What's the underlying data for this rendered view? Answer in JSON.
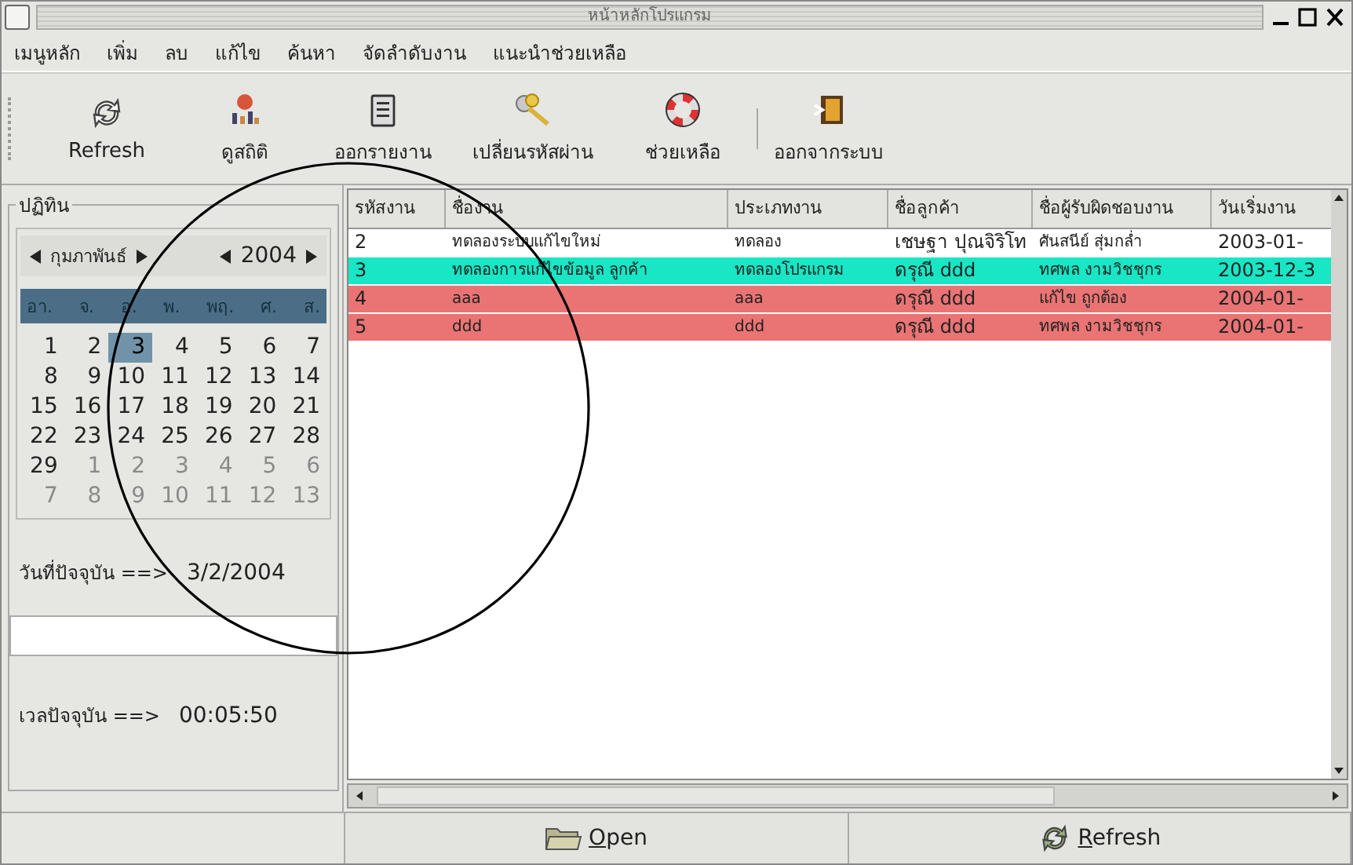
{
  "window": {
    "title": "หน้าหลักโปรแกรม"
  },
  "menu": [
    "เมนูหลัก",
    "เพิ่ม",
    "ลบ",
    "แก้ไข",
    "ค้นหา",
    "จัดลำดับงาน",
    "แนะนำช่วยเหลือ"
  ],
  "toolbar": [
    {
      "kind": "refresh",
      "label": "Refresh"
    },
    {
      "kind": "stats",
      "label": "ดูสถิติ"
    },
    {
      "kind": "report",
      "label": "ออกรายงาน"
    },
    {
      "kind": "keys",
      "label": "เปลี่ยนรหัสผ่าน"
    },
    {
      "kind": "help",
      "label": "ช่วยเหลือ"
    },
    {
      "kind": "exit",
      "label": "ออกจากระบบ"
    }
  ],
  "calendar": {
    "frame_label": "ปฏิทิน",
    "month": "กุมภาพันธ์",
    "year": "2004",
    "weekdays": [
      "อา.",
      "จ.",
      "อ.",
      "พ.",
      "พฤ.",
      "ศ.",
      "ส."
    ],
    "days": [
      {
        "label": "1",
        "selected": false,
        "muted": false
      },
      {
        "label": "2",
        "selected": false,
        "muted": false
      },
      {
        "label": "3",
        "selected": true,
        "muted": false
      },
      {
        "label": "4",
        "selected": false,
        "muted": false
      },
      {
        "label": "5",
        "selected": false,
        "muted": false
      },
      {
        "label": "6",
        "selected": false,
        "muted": false
      },
      {
        "label": "7",
        "selected": false,
        "muted": false
      },
      {
        "label": "8",
        "selected": false,
        "muted": false
      },
      {
        "label": "9",
        "selected": false,
        "muted": false
      },
      {
        "label": "10",
        "selected": false,
        "muted": false
      },
      {
        "label": "11",
        "selected": false,
        "muted": false
      },
      {
        "label": "12",
        "selected": false,
        "muted": false
      },
      {
        "label": "13",
        "selected": false,
        "muted": false
      },
      {
        "label": "14",
        "selected": false,
        "muted": false
      },
      {
        "label": "15",
        "selected": false,
        "muted": false
      },
      {
        "label": "16",
        "selected": false,
        "muted": false
      },
      {
        "label": "17",
        "selected": false,
        "muted": false
      },
      {
        "label": "18",
        "selected": false,
        "muted": false
      },
      {
        "label": "19",
        "selected": false,
        "muted": false
      },
      {
        "label": "20",
        "selected": false,
        "muted": false
      },
      {
        "label": "21",
        "selected": false,
        "muted": false
      },
      {
        "label": "22",
        "selected": false,
        "muted": false
      },
      {
        "label": "23",
        "selected": false,
        "muted": false
      },
      {
        "label": "24",
        "selected": false,
        "muted": false
      },
      {
        "label": "25",
        "selected": false,
        "muted": false
      },
      {
        "label": "26",
        "selected": false,
        "muted": false
      },
      {
        "label": "27",
        "selected": false,
        "muted": false
      },
      {
        "label": "28",
        "selected": false,
        "muted": false
      },
      {
        "label": "29",
        "selected": false,
        "muted": false
      },
      {
        "label": "1",
        "selected": false,
        "muted": true
      },
      {
        "label": "2",
        "selected": false,
        "muted": true
      },
      {
        "label": "3",
        "selected": false,
        "muted": true
      },
      {
        "label": "4",
        "selected": false,
        "muted": true
      },
      {
        "label": "5",
        "selected": false,
        "muted": true
      },
      {
        "label": "6",
        "selected": false,
        "muted": true
      },
      {
        "label": "7",
        "selected": false,
        "muted": true
      },
      {
        "label": "8",
        "selected": false,
        "muted": true
      },
      {
        "label": "9",
        "selected": false,
        "muted": true
      },
      {
        "label": "10",
        "selected": false,
        "muted": true
      },
      {
        "label": "11",
        "selected": false,
        "muted": true
      },
      {
        "label": "12",
        "selected": false,
        "muted": true
      },
      {
        "label": "13",
        "selected": false,
        "muted": true
      }
    ]
  },
  "current_date": {
    "label": "วันที่ปัจจุบัน ==>",
    "value": "3/2/2004"
  },
  "current_time": {
    "label": "เวลปัจจุบัน ==>",
    "value": "00:05:50"
  },
  "table": {
    "columns": [
      "รหัสงาน",
      "ชื่องาน",
      "ประเภทงาน",
      "ชื่อลูกค้า",
      "ชื่อผู้รับผิดชอบงาน",
      "วันเริ่มงาน"
    ],
    "rows": [
      {
        "color": "#ffffff",
        "cells": [
          "2",
          "ทดลองระบบแก้ไขใหม่",
          "ทดลอง",
          "เชษฐา ปุณจิริโท",
          "ศันสนีย์ สุ่มกล่ำ",
          "2003-01-"
        ]
      },
      {
        "color": "#18e6c4",
        "cells": [
          "3",
          "ทดลองการแก้ไขข้อมูล ลูกค้า",
          "ทดลองโปรแกรม",
          "ดรุณี ddd",
          "ทศพล งามวิชชุกร",
          "2003-12-3"
        ]
      },
      {
        "color": "#ea7474",
        "cells": [
          "4",
          "aaa",
          "aaa",
          "ดรุณี ddd",
          "แก้ไข ถูกต้อง",
          "2004-01-"
        ]
      },
      {
        "color": "#ea7474",
        "cells": [
          "5",
          "ddd",
          "ddd",
          "ดรุณี ddd",
          "ทศพล งามวิชชุกร",
          "2004-01-"
        ]
      }
    ]
  },
  "buttons": [
    {
      "kind": "open",
      "label": "Open"
    },
    {
      "kind": "refresh",
      "label": "Refresh"
    }
  ]
}
